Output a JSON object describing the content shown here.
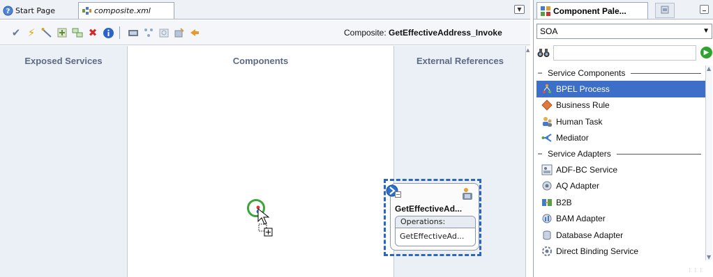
{
  "editor": {
    "tabs": [
      {
        "label": "Start Page",
        "icon": "help-circle-icon"
      },
      {
        "label": "composite.xml",
        "icon": "composite-icon"
      }
    ],
    "toolbar": {
      "icons": [
        "validate-checkmark-icon",
        "lightning-icon",
        "wire-icon",
        "add-icon",
        "link-icon",
        "delete-x-icon",
        "info-icon",
        "deploy-icon",
        "layout-icon",
        "zoom-icon",
        "properties-icon",
        "run-icon"
      ],
      "composite_label": "Composite:",
      "composite_name": "GetEffectiveAddress_Invoke"
    },
    "columns": {
      "exposed": "Exposed Services",
      "components": "Components",
      "external": "External References"
    },
    "reference": {
      "title": "GetEffectiveAd...",
      "collapse": "−",
      "operations_header": "Operations:",
      "operation": "GetEffectiveAd..."
    }
  },
  "palette": {
    "tab_title": "Component Pale...",
    "category": "SOA",
    "search_placeholder": "",
    "groups": [
      {
        "label": "Service Components",
        "items": [
          {
            "label": "BPEL Process",
            "icon": "bpel-process-icon",
            "selected": true
          },
          {
            "label": "Business Rule",
            "icon": "business-rule-icon"
          },
          {
            "label": "Human Task",
            "icon": "human-task-icon"
          },
          {
            "label": "Mediator",
            "icon": "mediator-icon"
          }
        ]
      },
      {
        "label": "Service Adapters",
        "items": [
          {
            "label": "ADF-BC Service",
            "icon": "adf-bc-icon"
          },
          {
            "label": "AQ Adapter",
            "icon": "aq-adapter-icon"
          },
          {
            "label": "B2B",
            "icon": "b2b-icon"
          },
          {
            "label": "BAM Adapter",
            "icon": "bam-adapter-icon"
          },
          {
            "label": "Database Adapter",
            "icon": "database-adapter-icon"
          },
          {
            "label": "Direct Binding Service",
            "icon": "direct-binding-icon"
          }
        ]
      }
    ]
  },
  "colors": {
    "selection": "#3d6fc9",
    "column_bg": "#ebeff6",
    "column_title": "#5b6a85",
    "ref_dashed": "#2b66c0",
    "drag_ring": "#3aa53a"
  }
}
